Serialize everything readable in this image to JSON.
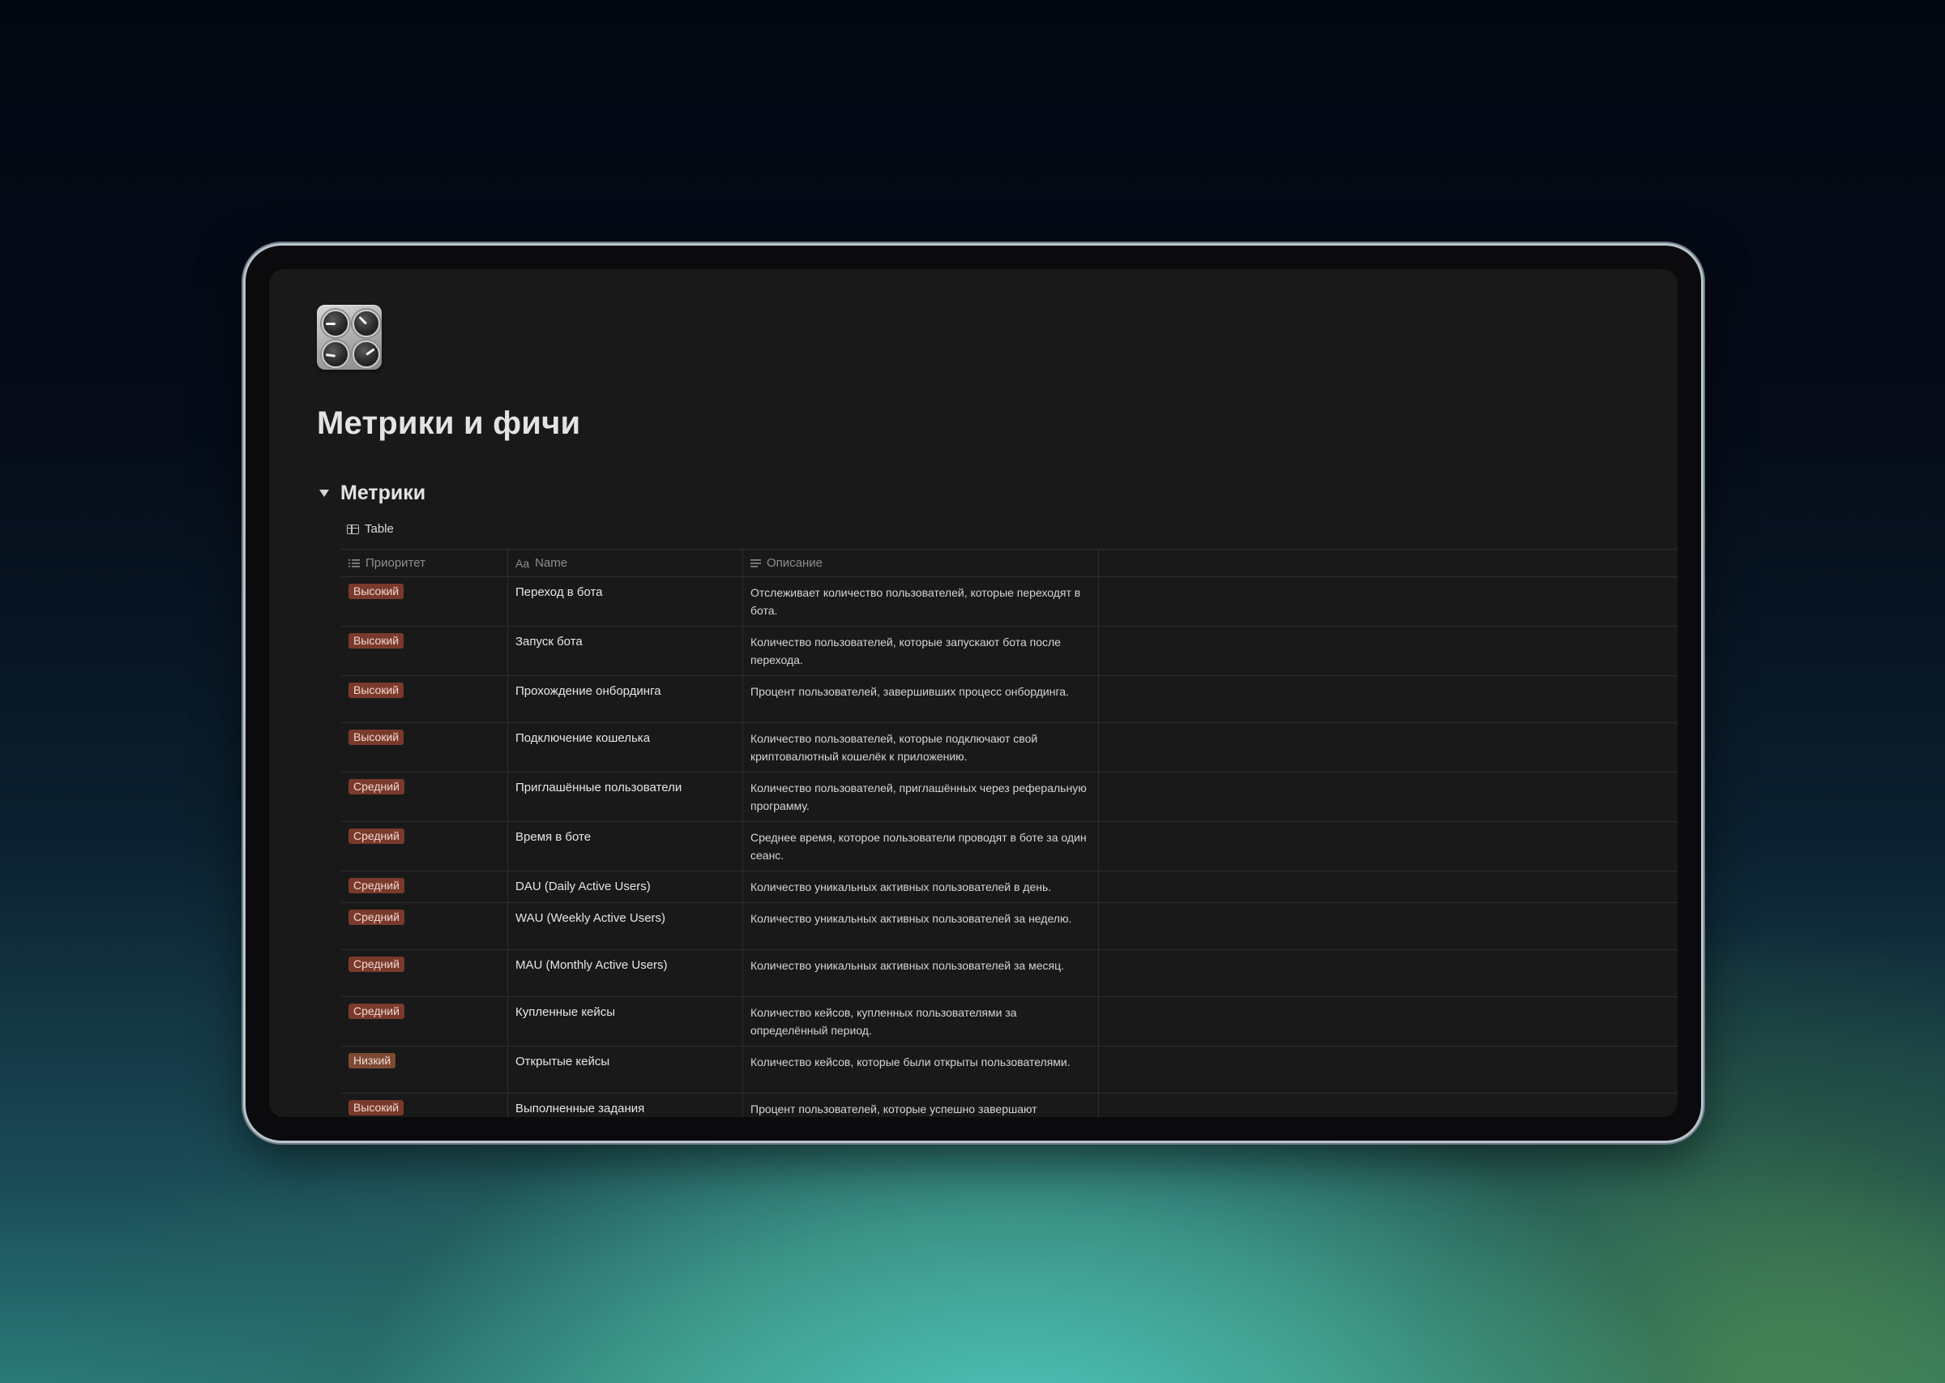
{
  "page": {
    "title": "Метрики и фичи",
    "icon": "control-knobs-icon"
  },
  "section": {
    "heading": "Метрики",
    "view_label": "Table"
  },
  "table": {
    "columns": [
      {
        "label": "Приоритет",
        "icon": "list-icon"
      },
      {
        "label": "Name",
        "icon": "Aa"
      },
      {
        "label": "Описание",
        "icon": "text-lines-icon"
      }
    ],
    "rows": [
      {
        "priority": "Высокий",
        "name": "Переход в бота",
        "description": "Отслеживает количество пользователей, которые переходят в бота."
      },
      {
        "priority": "Высокий",
        "name": "Запуск бота",
        "description": "Количество пользователей, которые запускают бота после перехода."
      },
      {
        "priority": "Высокий",
        "name": "Прохождение онбординга",
        "description": "Процент пользователей, завершивших процесс онбординга."
      },
      {
        "priority": "Высокий",
        "name": "Подключение кошелька",
        "description": "Количество пользователей, которые подключают свой криптовалютный кошелёк к приложению."
      },
      {
        "priority": "Средний",
        "name": "Приглашённые пользователи",
        "description": "Количество пользователей, приглашённых через реферальную программу."
      },
      {
        "priority": "Средний",
        "name": "Время в боте",
        "description": "Среднее время, которое пользователи проводят в боте за один сеанс."
      },
      {
        "priority": "Средний",
        "name": "DAU (Daily Active Users)",
        "description": "Количество уникальных активных пользователей в день."
      },
      {
        "priority": "Средний",
        "name": "WAU (Weekly Active Users)",
        "description": "Количество уникальных активных пользователей за неделю."
      },
      {
        "priority": "Средний",
        "name": "MAU (Monthly Active Users)",
        "description": "Количество уникальных активных пользователей за месяц."
      },
      {
        "priority": "Средний",
        "name": "Купленные кейсы",
        "description": "Количество кейсов, купленных пользователями за определённый период."
      },
      {
        "priority": "Низкий",
        "name": "Открытые кейсы",
        "description": "Количество кейсов, которые были открыты пользователями."
      },
      {
        "priority": "Высокий",
        "name": "Выполненные задания",
        "description": "Процент пользователей, которые успешно завершают ежедневные или еженедельные задания."
      }
    ]
  },
  "colors": {
    "badge_bg": "#7a3a2b",
    "page_bg": "#191919"
  }
}
